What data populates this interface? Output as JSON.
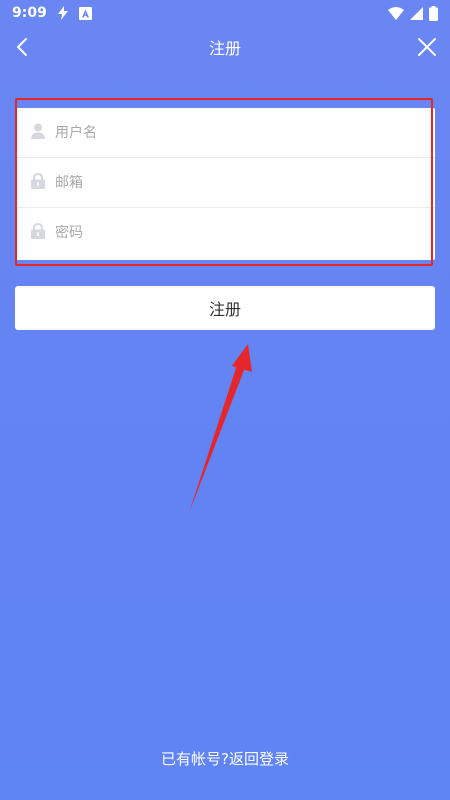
{
  "status_bar": {
    "time": "9:09",
    "icons": [
      "flash-icon",
      "autofill-icon",
      "wifi-icon",
      "signal-icon",
      "battery-icon"
    ]
  },
  "nav": {
    "title": "注册",
    "back_icon": "chevron-left-icon",
    "close_icon": "close-icon"
  },
  "form": {
    "fields": [
      {
        "name": "username",
        "placeholder": "用户名",
        "value": "",
        "icon": "user-icon"
      },
      {
        "name": "email",
        "placeholder": "邮箱",
        "value": "",
        "icon": "lock-icon"
      },
      {
        "name": "password",
        "placeholder": "密码",
        "value": "",
        "icon": "lock-icon"
      }
    ]
  },
  "submit_label": "注册",
  "login_link": "已有帐号?返回登录",
  "colors": {
    "background": "#6283f3",
    "annotation_red": "#e5262a",
    "card": "#ffffff"
  }
}
